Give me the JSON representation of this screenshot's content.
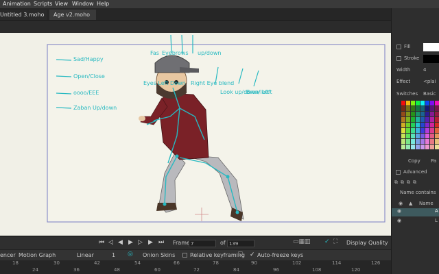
{
  "menu": [
    "Animation",
    "Scripts",
    "View",
    "Window",
    "Help"
  ],
  "tabs": [
    {
      "label": "Untitled 3.moho"
    },
    {
      "label": "Age v2.moho"
    }
  ],
  "canvas_labels": {
    "sad_happy": "Sad/Happy",
    "open_close": "Open/Close",
    "oooo_eee": "oooo/EEE",
    "zaban": "Zaban Up/down",
    "fas": "Fas",
    "brows": "Eyebrows",
    "up_down": "up/down",
    "eye_left": "Eyes Left Down",
    "eye_right": "Right Eye blend",
    "look": "Look up/down/left",
    "brow_left": "Brow Left"
  },
  "right_panel": {
    "fill": "Fill",
    "stroke": "Stroke",
    "width_label": "Width",
    "width_value": "4",
    "effect_label": "Effect",
    "effect_value": "<plai",
    "switches": "Switches",
    "basic": "Basic",
    "copy": "Copy",
    "paste": "Pa",
    "advanced": "Advanced",
    "name_contains": "Name contains",
    "name_col": "Name",
    "row1": "A",
    "row2": "L"
  },
  "playbar": {
    "frame_label": "Frame",
    "frame_value": "7",
    "of_label": "of",
    "total_frames": "139",
    "display_quality": "Display Quality"
  },
  "timeline": {
    "sequencer": "encer",
    "motion_graph": "Motion Graph",
    "interp": "Linear",
    "interp_num": "1",
    "onion_skins": "Onion Skins",
    "relative_keyframing": "Relative keyframing",
    "auto_freeze": "Auto-freeze keys"
  },
  "ruler_top": [
    "18",
    "30",
    "42",
    "54",
    "66",
    "78",
    "90",
    "102",
    "114",
    "126"
  ],
  "ruler_bottom": [
    "24",
    "36",
    "48",
    "60",
    "72",
    "84",
    "96",
    "108",
    "120"
  ],
  "colors": {
    "accent": "#27b9c1",
    "canvas_bg": "#d8d6cc",
    "stage_bg": "#f1f0e7",
    "frame_border": "#8c8fc9"
  }
}
